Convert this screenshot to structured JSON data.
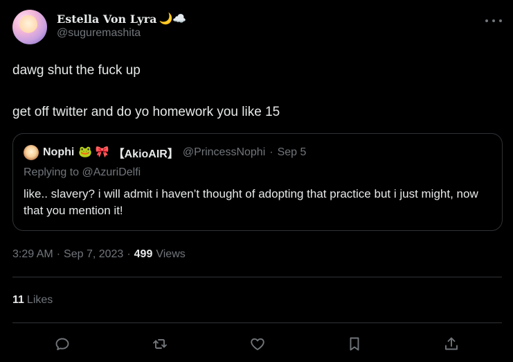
{
  "author": {
    "display_name": "Estella Von Lyra",
    "emoji": "🌙☁️",
    "handle": "@suguremashita"
  },
  "tweet": {
    "lines": [
      "dawg shut the fuck up",
      "get off twitter and do yo homework you like 15"
    ]
  },
  "quote": {
    "name": "Nophi",
    "emoji": "🐸 🎀",
    "tag": "【AkioAIR】",
    "handle": "@PrincessNophi",
    "separator": "·",
    "date": "Sep 5",
    "replying_to": "Replying to @AzuriDelfi",
    "text": "like.. slavery? i will admit i haven’t thought of adopting that practice but i just might, now that you mention it!"
  },
  "meta": {
    "time": "3:29 AM",
    "sep1": "·",
    "date": "Sep 7, 2023",
    "sep2": "·",
    "views_count": "499",
    "views_label": "Views"
  },
  "likes": {
    "count": "11",
    "label": "Likes"
  },
  "actions": {
    "icons": [
      "reply-icon",
      "retweet-icon",
      "like-icon",
      "bookmark-icon",
      "share-icon"
    ]
  }
}
